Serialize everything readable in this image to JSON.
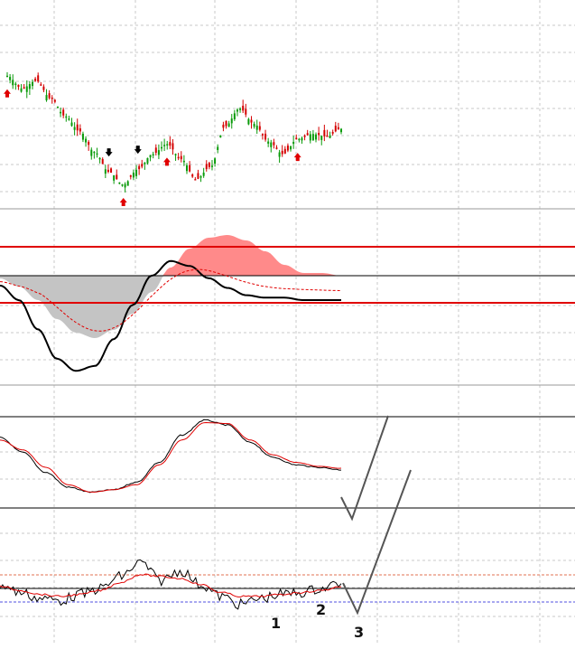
{
  "chart_data": [
    {
      "type": "candlestick",
      "panel": "price",
      "up_color": "#0a9a0a",
      "down_color": "#d40000",
      "arrow_colors": {
        "buy": "#e00000",
        "sell": "#000000"
      },
      "candles_approx": [
        [
          1,
          0.0,
          0.4,
          -0.2,
          0.5
        ],
        [
          2,
          0.5,
          -0.1,
          -0.3,
          0.7
        ],
        [
          3,
          -0.1,
          0.2,
          -0.4,
          0.4
        ],
        [
          4,
          0.2,
          -0.5,
          -0.7,
          0.3
        ],
        [
          5,
          -0.5,
          -1.2,
          -1.4,
          -0.4
        ],
        [
          6,
          -1.2,
          -1.8,
          -2.0,
          -1.0
        ],
        [
          7,
          -1.8,
          -2.6,
          -2.9,
          -1.6
        ],
        [
          8,
          -2.6,
          -3.4,
          -3.8,
          -2.4
        ],
        [
          9,
          -3.4,
          -3.9,
          -4.2,
          -3.2
        ],
        [
          10,
          -3.9,
          -3.3,
          -4.0,
          -3.1
        ],
        [
          11,
          -3.3,
          -2.7,
          -3.5,
          -2.5
        ],
        [
          12,
          -2.7,
          -2.3,
          -2.9,
          -2.1
        ],
        [
          13,
          -2.3,
          -2.9,
          -3.3,
          -2.1
        ],
        [
          14,
          -2.9,
          -3.7,
          -4.0,
          -2.7
        ],
        [
          15,
          -3.7,
          -3.2,
          -3.9,
          -3.0
        ],
        [
          16,
          -3.2,
          -1.6,
          -3.3,
          -1.5
        ],
        [
          17,
          -1.6,
          -0.9,
          -1.8,
          -0.7
        ],
        [
          18,
          -0.9,
          -1.5,
          -1.7,
          -0.8
        ],
        [
          19,
          -1.5,
          -2.2,
          -2.4,
          -1.3
        ],
        [
          20,
          -2.2,
          -2.7,
          -3.0,
          -2.0
        ],
        [
          21,
          -2.7,
          -2.1,
          -2.9,
          -1.9
        ],
        [
          22,
          -2.1,
          -1.9,
          -2.3,
          -1.7
        ],
        [
          23,
          -1.9,
          -2.0,
          -2.2,
          -1.8
        ],
        [
          24,
          -2.0,
          -1.7,
          -2.3,
          -1.6
        ]
      ],
      "signal_arrows_approx": [
        {
          "type": "buy",
          "bar": 1
        },
        {
          "type": "sell",
          "bar": 8
        },
        {
          "type": "buy",
          "bar": 9
        },
        {
          "type": "sell",
          "bar": 10
        },
        {
          "type": "buy",
          "bar": 12
        },
        {
          "type": "buy",
          "bar": 21
        }
      ]
    },
    {
      "type": "area",
      "panel": "oscillator",
      "positive_fill_color": "#ff8a8a",
      "negative_fill_color": "#c4c4c4",
      "main_line_color": "#000000",
      "signal_line_color": "#e00000",
      "signal_line_style": "dotted",
      "level_color": "#e00000",
      "levels": [
        1,
        -1
      ],
      "zero_line": 0,
      "histogram_approx": [
        -0.1,
        -0.4,
        -0.9,
        -1.6,
        -2.1,
        -2.3,
        -2.0,
        -1.4,
        -0.6,
        0.3,
        1.0,
        1.4,
        1.5,
        1.3,
        0.9,
        0.4,
        0.1,
        0.1,
        0.0
      ],
      "line_approx": [
        -0.4,
        -1.0,
        -2.2,
        -3.4,
        -3.9,
        -3.7,
        -2.6,
        -1.2,
        0.0,
        0.6,
        0.4,
        -0.1,
        -0.5,
        -0.8,
        -0.9,
        -0.9,
        -1.0,
        -1.0,
        -1.0
      ]
    },
    {
      "type": "line",
      "panel": "smoothed",
      "series": [
        {
          "values": [
            0.5,
            0.2,
            -0.2,
            -0.5,
            -0.6,
            -0.55,
            -0.4,
            0.0,
            0.55,
            0.85,
            0.75,
            0.4,
            0.1,
            -0.05,
            -0.1,
            -0.15
          ],
          "color": "#000000"
        },
        {
          "values": [
            0.45,
            0.25,
            -0.1,
            -0.45,
            -0.6,
            -0.55,
            -0.45,
            -0.05,
            0.45,
            0.8,
            0.78,
            0.45,
            0.15,
            0.0,
            -0.08,
            -0.12
          ],
          "color": "#e00000"
        }
      ],
      "ylim": [
        -1,
        1
      ]
    },
    {
      "type": "line",
      "panel": "fast-oscillator",
      "series": [
        {
          "values": [
            0.2,
            -0.2,
            -0.5,
            -0.6,
            -0.3,
            0.0,
            0.6,
            1.3,
            0.4,
            0.9,
            0.2,
            -0.4,
            -0.8,
            -0.5,
            -0.3,
            -0.2,
            0.0,
            0.3
          ],
          "color": "#000000"
        },
        {
          "values": [
            0.1,
            -0.1,
            -0.3,
            -0.4,
            -0.3,
            -0.1,
            0.3,
            0.7,
            0.6,
            0.5,
            0.2,
            -0.2,
            -0.4,
            -0.4,
            -0.3,
            -0.2,
            -0.1,
            0.1
          ],
          "color": "#e00000"
        }
      ],
      "levels": [
        {
          "value": 0.5,
          "color": "#e07050"
        },
        {
          "value": -0.5,
          "color": "#5050e0"
        }
      ]
    }
  ],
  "annotations": {
    "labels": [
      "1",
      "2",
      "3"
    ],
    "drawing_color": "#555555"
  }
}
